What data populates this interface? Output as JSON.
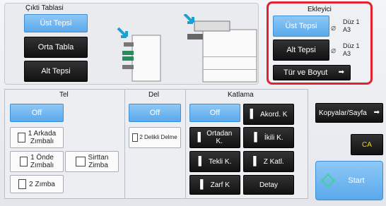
{
  "output_tray": {
    "title": "Çıkti Tablasi",
    "buttons": [
      "Üst Tepsi",
      "Orta Tabla",
      "Alt Tepsi"
    ]
  },
  "inserter": {
    "title": "Ekleyici",
    "upper_label": "Üst Tepsi",
    "upper_paper": "Düz 1",
    "upper_size": "A3",
    "lower_label": "Alt Tepsi",
    "lower_paper": "Düz 1",
    "lower_size": "A3",
    "type_size_button": "Tür ve Boyut"
  },
  "tel": {
    "title": "Tel",
    "off": "Off",
    "one_back": "1 Arkada\nZımbalı",
    "one_front": "1 Önde\nZımbalı",
    "saddle": "Sirttan\nZimba",
    "two_staple": "2 Zımba"
  },
  "del": {
    "title": "Del",
    "off": "Off",
    "two_hole": "2 Delikli Delme"
  },
  "fold": {
    "title": "Katlama",
    "off": "Off",
    "accordion": "Akord. K",
    "center": "Ortadan\nK.",
    "double": "İkili K.",
    "single": "Tekli K.",
    "z_fold": "Z Katl.",
    "envelope": "Zarf K",
    "detail": "Detay"
  },
  "side": {
    "copies_per_set": "Kopyalar/Sayfa",
    "ca": "CA",
    "start": "Start"
  }
}
